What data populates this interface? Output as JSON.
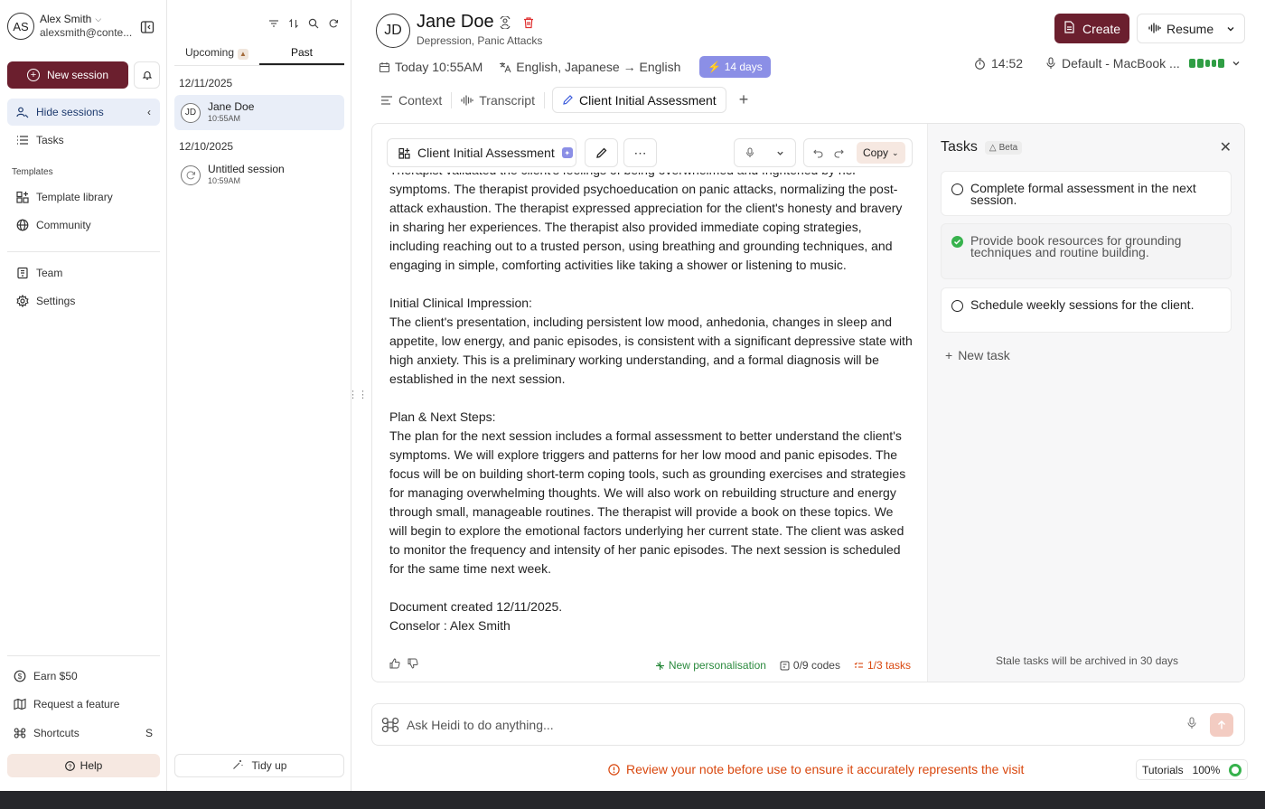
{
  "user": {
    "initials": "AS",
    "name": "Alex Smith",
    "email": "alexsmith@conte..."
  },
  "nav": {
    "new_session": "New session",
    "hide_sessions": "Hide sessions",
    "tasks": "Tasks",
    "templates_section": "Templates",
    "template_library": "Template library",
    "community": "Community",
    "team": "Team",
    "settings": "Settings",
    "earn": "Earn $50",
    "request_feature": "Request a feature",
    "shortcuts": "Shortcuts",
    "shortcuts_key": "S",
    "help": "Help"
  },
  "sessions": {
    "tabs": {
      "upcoming": "Upcoming",
      "past": "Past"
    },
    "groups": [
      {
        "date": "12/11/2025",
        "items": [
          {
            "initials": "JD",
            "name": "Jane Doe",
            "time": "10:55AM"
          }
        ]
      },
      {
        "date": "12/10/2025",
        "items": [
          {
            "name": "Untitled session",
            "time": "10:59AM"
          }
        ]
      }
    ],
    "tidy_up": "Tidy up"
  },
  "patient": {
    "initials": "JD",
    "name": "Jane Doe",
    "subtitle": "Depression, Panic Attacks"
  },
  "header": {
    "create": "Create",
    "resume": "Resume",
    "date": "Today 10:55AM",
    "languages": "English, Japanese → English",
    "days_badge": "14 days",
    "timer": "14:52",
    "microphone": "Default - MacBook ..."
  },
  "note_tabs": {
    "context": "Context",
    "transcript": "Transcript",
    "assessment": "Client Initial Assessment"
  },
  "note": {
    "template_name": "Client Initial Assessment",
    "copy_label": "Copy",
    "clipped_line": "Therapist validated the client's feelings of being overwhelmed and frightened by her",
    "para1": "symptoms. The therapist provided psychoeducation on panic attacks, normalizing the post-attack exhaustion. The therapist expressed appreciation for the client's honesty and bravery in sharing her experiences. The therapist also provided immediate coping strategies, including reaching out to a trusted person, using breathing and grounding techniques, and engaging in simple, comforting activities like taking a shower or listening to music.",
    "impression_heading": "Initial Clinical Impression:",
    "impression_body": "The client's presentation, including persistent low mood, anhedonia, changes in sleep and appetite, low energy, and panic episodes, is consistent with a significant depressive state with high anxiety. This is a preliminary working understanding, and a formal diagnosis will be established in the next session.",
    "plan_heading": "Plan & Next Steps:",
    "plan_body": "The plan for the next session includes a formal assessment to better understand the client's symptoms. We will explore triggers and patterns for her low mood and panic episodes. The focus will be on building short-term coping tools, such as grounding exercises and strategies for managing overwhelming thoughts. We will also work on rebuilding structure and energy through small, manageable routines. The therapist will provide a book on these topics. We will begin to explore the emotional factors underlying her current state. The client was asked to monitor the frequency and intensity of her panic episodes. The next session is scheduled for the same time next week.",
    "created": "Document created 12/11/2025.",
    "counselor": "Conselor : Alex Smith",
    "footer": {
      "personalisation": "New personalisation",
      "codes": "0/9 codes",
      "tasks": "1/3 tasks"
    }
  },
  "tasks": {
    "title": "Tasks",
    "beta": "Beta",
    "items": [
      {
        "text": "Complete formal assessment in the next session.",
        "done": false
      },
      {
        "text": "Provide book resources for grounding techniques and routine building.",
        "done": true
      },
      {
        "text": "Schedule weekly sessions for the client.",
        "done": false
      }
    ],
    "new_task": "New task",
    "stale_note": "Stale tasks will be archived in 30 days"
  },
  "ask": {
    "placeholder": "Ask Heidi to do anything..."
  },
  "warning": "Review your note before use to ensure it accurately represents the visit",
  "tutorials": {
    "label": "Tutorials",
    "zoom": "100%"
  },
  "colors": {
    "brand": "#6b1f2e",
    "accent_purple": "#8b8fe6",
    "success": "#37b24d",
    "warning": "#d9480f"
  }
}
